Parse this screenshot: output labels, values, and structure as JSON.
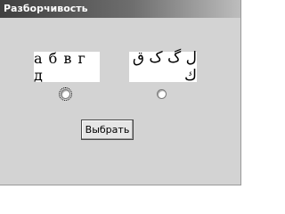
{
  "window": {
    "title": "Разборчивость"
  },
  "options": [
    {
      "sample_text": "а б в г д",
      "selected": false
    },
    {
      "sample_text": "ﻝ ﮒ ﮎ ﻕ ﻙ",
      "selected": false
    }
  ],
  "button": {
    "label": "Выбрать"
  },
  "colors": {
    "window_bg": "#d3d3d3",
    "title_fg": "#ffffff",
    "title_gradient_start": "#3f3f3f",
    "title_gradient_end": "#bdbdbd",
    "sample_bg": "#ffffff"
  }
}
